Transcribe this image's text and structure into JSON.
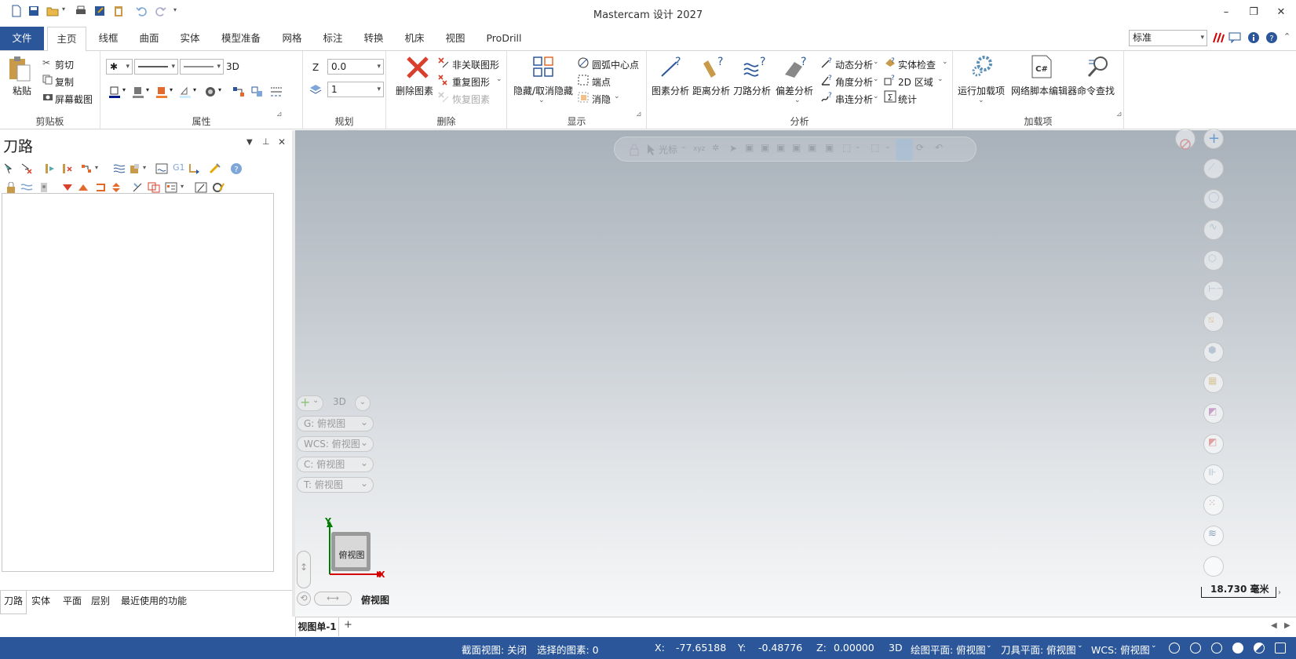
{
  "window": {
    "title": "Mastercam 设计 2027",
    "minimize": "–",
    "restore": "❐",
    "close": "✕"
  },
  "tabs": [
    {
      "label": "文件"
    },
    {
      "label": "主页"
    },
    {
      "label": "线框"
    },
    {
      "label": "曲面"
    },
    {
      "label": "实体"
    },
    {
      "label": "模型准备"
    },
    {
      "label": "网格"
    },
    {
      "label": "标注"
    },
    {
      "label": "转换"
    },
    {
      "label": "机床"
    },
    {
      "label": "视图"
    },
    {
      "label": "ProDrill"
    }
  ],
  "style_select": {
    "value": "标准"
  },
  "ribbon": {
    "clipboard": {
      "label": "剪贴板",
      "paste": "粘贴",
      "cut": "剪切",
      "copy": "复制",
      "screenshot": "屏幕截图"
    },
    "attributes": {
      "label": "属性",
      "three_d": "3D"
    },
    "planning": {
      "label": "规划",
      "z_label": "Z",
      "z_value": "0.0",
      "level_value": "1"
    },
    "delete": {
      "label": "删除",
      "delete_entity": "删除图素",
      "non_assoc": "非关联图形",
      "duplicate": "重复图形",
      "restore": "恢复图素"
    },
    "display": {
      "label": "显示",
      "hide_unhide": "隐藏/取消隐藏",
      "arc_center": "圆弧中心点",
      "endpoints": "端点",
      "blank": "消隐"
    },
    "analyze": {
      "label": "分析",
      "entity": "图素分析",
      "distance": "距离分析",
      "toolpath": "刀路分析",
      "deviation": "偏差分析",
      "dynamic": "动态分析",
      "angle": "角度分析",
      "chain": "串连分析",
      "solid_check": "实体检查",
      "area2d": "2D 区域",
      "stats": "统计"
    },
    "addins": {
      "label": "加载项",
      "run": "运行加载项",
      "net_script": "网络脚本编辑器",
      "cmd_finder": "命令查找"
    }
  },
  "panel": {
    "title": "刀路",
    "bottom_tabs": [
      {
        "label": "刀路"
      },
      {
        "label": "实体"
      },
      {
        "label": "平面"
      },
      {
        "label": "层别"
      },
      {
        "label": "最近使用的功能"
      }
    ]
  },
  "graphics": {
    "selection_bar": {
      "cursor_label": "光标"
    },
    "view_controls": {
      "three_d": "3D",
      "g_plane": "G: 俯视图",
      "wcs": "WCS: 俯视图",
      "c_plane": "C: 俯视图",
      "t_plane": "T: 俯视图"
    },
    "view_cube": {
      "label": "俯视图",
      "x": "X",
      "y": "Y"
    },
    "view_name": "俯视图",
    "scale": "18.730 毫米",
    "viewsheet": "视图单-1",
    "add_sheet": "+"
  },
  "status": {
    "section_view": "截面视图: 关闭",
    "selected": "选择的图素: 0",
    "x_label": "X:",
    "x_value": "-77.65188",
    "y_label": "Y:",
    "y_value": "-0.48776",
    "z_label": "Z:",
    "z_value": "0.00000",
    "mode": "3D",
    "cplane": "绘图平面: 俯视图",
    "tplane": "刀具平面: 俯视图",
    "wcs": "WCS: 俯视图"
  },
  "colors": {
    "accent": "#2b579a",
    "delete_red": "#d9402b",
    "axis_x": "#d40000",
    "axis_y": "#007a00"
  }
}
